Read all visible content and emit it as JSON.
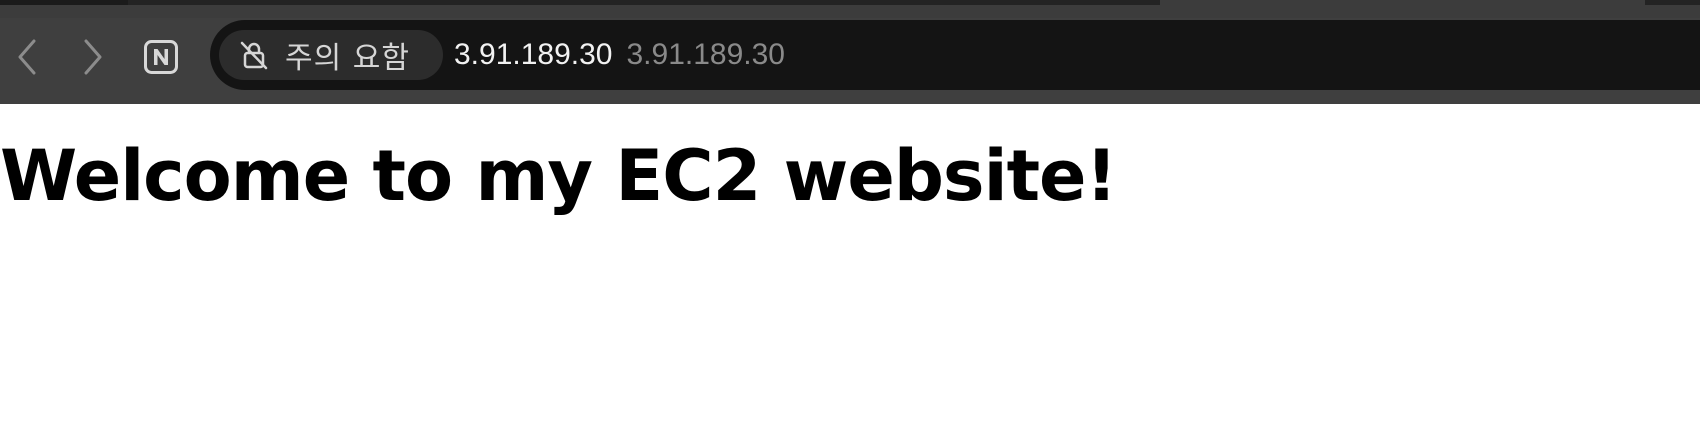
{
  "browser": {
    "security_chip": {
      "label": "주의 요함",
      "icon": "not-secure-lock-icon"
    },
    "address": {
      "host": "3.91.189.30",
      "suggestion": "3.91.189.30"
    },
    "nav": {
      "back_icon": "chevron-left-icon",
      "forward_icon": "chevron-right-icon",
      "site_icon": "naver-n-icon"
    },
    "colors": {
      "toolbar": "#3f3f3f",
      "address_bar": "#141414",
      "chip": "#2c2c2c"
    }
  },
  "page": {
    "heading": "Welcome to my EC2 website!"
  }
}
